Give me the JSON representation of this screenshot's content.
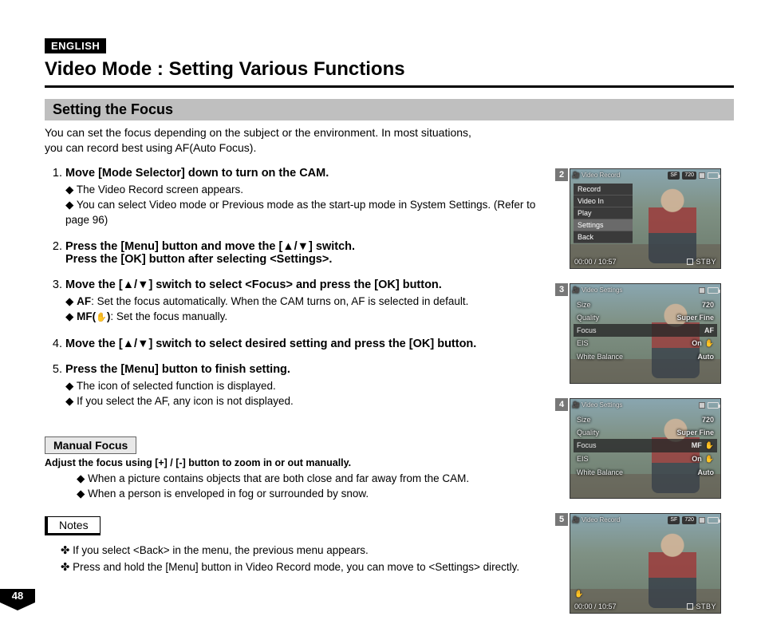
{
  "lang_badge": "ENGLISH",
  "title": "Video Mode : Setting Various Functions",
  "section": "Setting the Focus",
  "intro_l1": "You can set the focus depending on the subject or the environment. In most situations,",
  "intro_l2": "you can record best using AF(Auto Focus).",
  "steps": [
    {
      "h": "Move [Mode Selector] down to turn on the CAM.",
      "subs": [
        "The Video Record screen appears.",
        "You can select Video mode or Previous mode as the start-up mode in System Settings. (Refer to page 96)"
      ]
    },
    {
      "h_a": "Press the [Menu] button and move the [",
      "h_b": "] switch.",
      "h2": "Press the [OK] button after selecting <Settings>.",
      "subs": []
    },
    {
      "h_a": "Move the [",
      "h_b": "] switch to select <Focus> and press the [OK] button.",
      "subs_rich": [
        {
          "pre": "AF",
          "post": ": Set the focus automatically. When the CAM turns on, AF is selected in default."
        },
        {
          "pre": "MF(",
          "glyph": "✋",
          "mid": ")",
          "post": ": Set the focus manually."
        }
      ]
    },
    {
      "h_a": "Move the [",
      "h_b": "] switch to select desired setting and press the [OK] button.",
      "subs": []
    },
    {
      "h": "Press the [Menu] button to finish setting.",
      "subs": [
        "The icon of selected function is displayed.",
        "If you select the AF, any icon is not displayed."
      ]
    }
  ],
  "updown": "▲/▼",
  "manual_focus": {
    "heading": "Manual Focus",
    "lead_a": "Adjust the focus using [",
    "lead_plus": "+",
    "lead_mid": "] / [",
    "lead_minus": "-",
    "lead_b": "] button to zoom in or out manually.",
    "bullets": [
      "When a picture contains objects that are both close and far away from the CAM.",
      "When a person is enveloped in fog or surrounded by snow."
    ]
  },
  "notes_label": "Notes",
  "notes": [
    "If you select <Back> in the menu, the previous menu appears.",
    "Press and hold the [Menu] button in Video Record mode, you can move to <Settings> directly."
  ],
  "page_number": "48",
  "screens": {
    "s2": {
      "num": "2",
      "title": "Video Record",
      "pills": [
        "SF",
        "720"
      ],
      "menu": [
        "Record",
        "Video In",
        "Play",
        "Settings",
        "Back"
      ],
      "menu_sel_index": 3,
      "time": "00:00 / 10:57",
      "stby": "STBY"
    },
    "s3": {
      "num": "3",
      "title": "Video Settings",
      "rows": [
        {
          "k": "Size",
          "v": "720"
        },
        {
          "k": "Quality",
          "v": "Super Fine"
        },
        {
          "k": "Focus",
          "v": "AF",
          "sel": true
        },
        {
          "k": "EIS",
          "v": "On",
          "hand": true
        },
        {
          "k": "White Balance",
          "v": "Auto"
        }
      ]
    },
    "s4": {
      "num": "4",
      "title": "Video Settings",
      "rows": [
        {
          "k": "Size",
          "v": "720"
        },
        {
          "k": "Quality",
          "v": "Super Fine"
        },
        {
          "k": "Focus",
          "v": "MF",
          "sel": true,
          "hand": true
        },
        {
          "k": "EIS",
          "v": "On",
          "hand": true
        },
        {
          "k": "White Balance",
          "v": "Auto"
        }
      ]
    },
    "s5": {
      "num": "5",
      "title": "Video Record",
      "pills": [
        "SF",
        "720"
      ],
      "time": "00:00 / 10:57",
      "stby": "STBY",
      "mf_icon": "✋"
    }
  }
}
